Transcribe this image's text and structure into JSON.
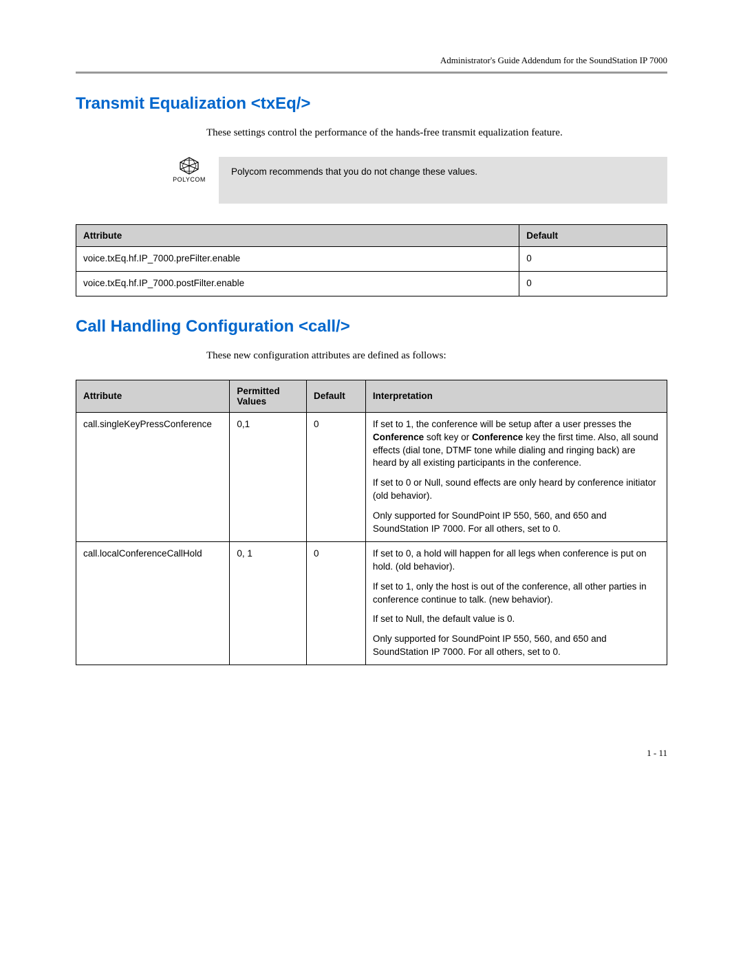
{
  "header": {
    "doc_title": "Administrator's Guide Addendum for the SoundStation IP 7000"
  },
  "section1": {
    "title": "Transmit Equalization <txEq/>",
    "intro": "These settings control the performance of the hands-free transmit equalization feature.",
    "callout_logo_label": "POLYCOM",
    "callout_text": "Polycom recommends that you do not change these values.",
    "table_headers": {
      "col1": "Attribute",
      "col2": "Default"
    },
    "rows": [
      {
        "attr": "voice.txEq.hf.IP_7000.preFilter.enable",
        "def": "0"
      },
      {
        "attr": "voice.txEq.hf.IP_7000.postFilter.enable",
        "def": "0"
      }
    ]
  },
  "section2": {
    "title": "Call Handling Configuration <call/>",
    "intro": "These new configuration attributes are defined as follows:",
    "table_headers": {
      "col1": "Attribute",
      "col2": "Permitted Values",
      "col3": "Default",
      "col4": "Interpretation"
    },
    "rows": [
      {
        "attr": "call.singleKeyPressConference",
        "perm": "0,1",
        "def": "0",
        "interp_pre": "If set to 1, the conference will be setup after a user presses the ",
        "interp_bold1": "Conference",
        "interp_mid1": " soft key or ",
        "interp_bold2": "Conference",
        "interp_mid2": " key the first time. Also, all sound effects (dial tone, DTMF tone while dialing and ringing back) are heard by all existing participants in the conference.",
        "interp_p2": "If set to 0 or Null, sound effects are only heard by conference initiator (old behavior).",
        "interp_p3": "Only supported for SoundPoint IP 550, 560, and 650 and SoundStation IP 7000. For all others, set to 0."
      },
      {
        "attr": "call.localConferenceCallHold",
        "perm": "0, 1",
        "def": "0",
        "interp_p1": "If set to 0, a hold will happen for all legs when conference is put on hold. (old behavior).",
        "interp_p2": "If set to 1, only the host is out of the conference, all other parties in conference continue to talk. (new behavior).",
        "interp_p3": "If set to Null, the default value is 0.",
        "interp_p4": "Only supported for SoundPoint IP 550, 560, and 650 and SoundStation IP 7000. For all others, set to 0."
      }
    ]
  },
  "page_number": "1 - 11"
}
